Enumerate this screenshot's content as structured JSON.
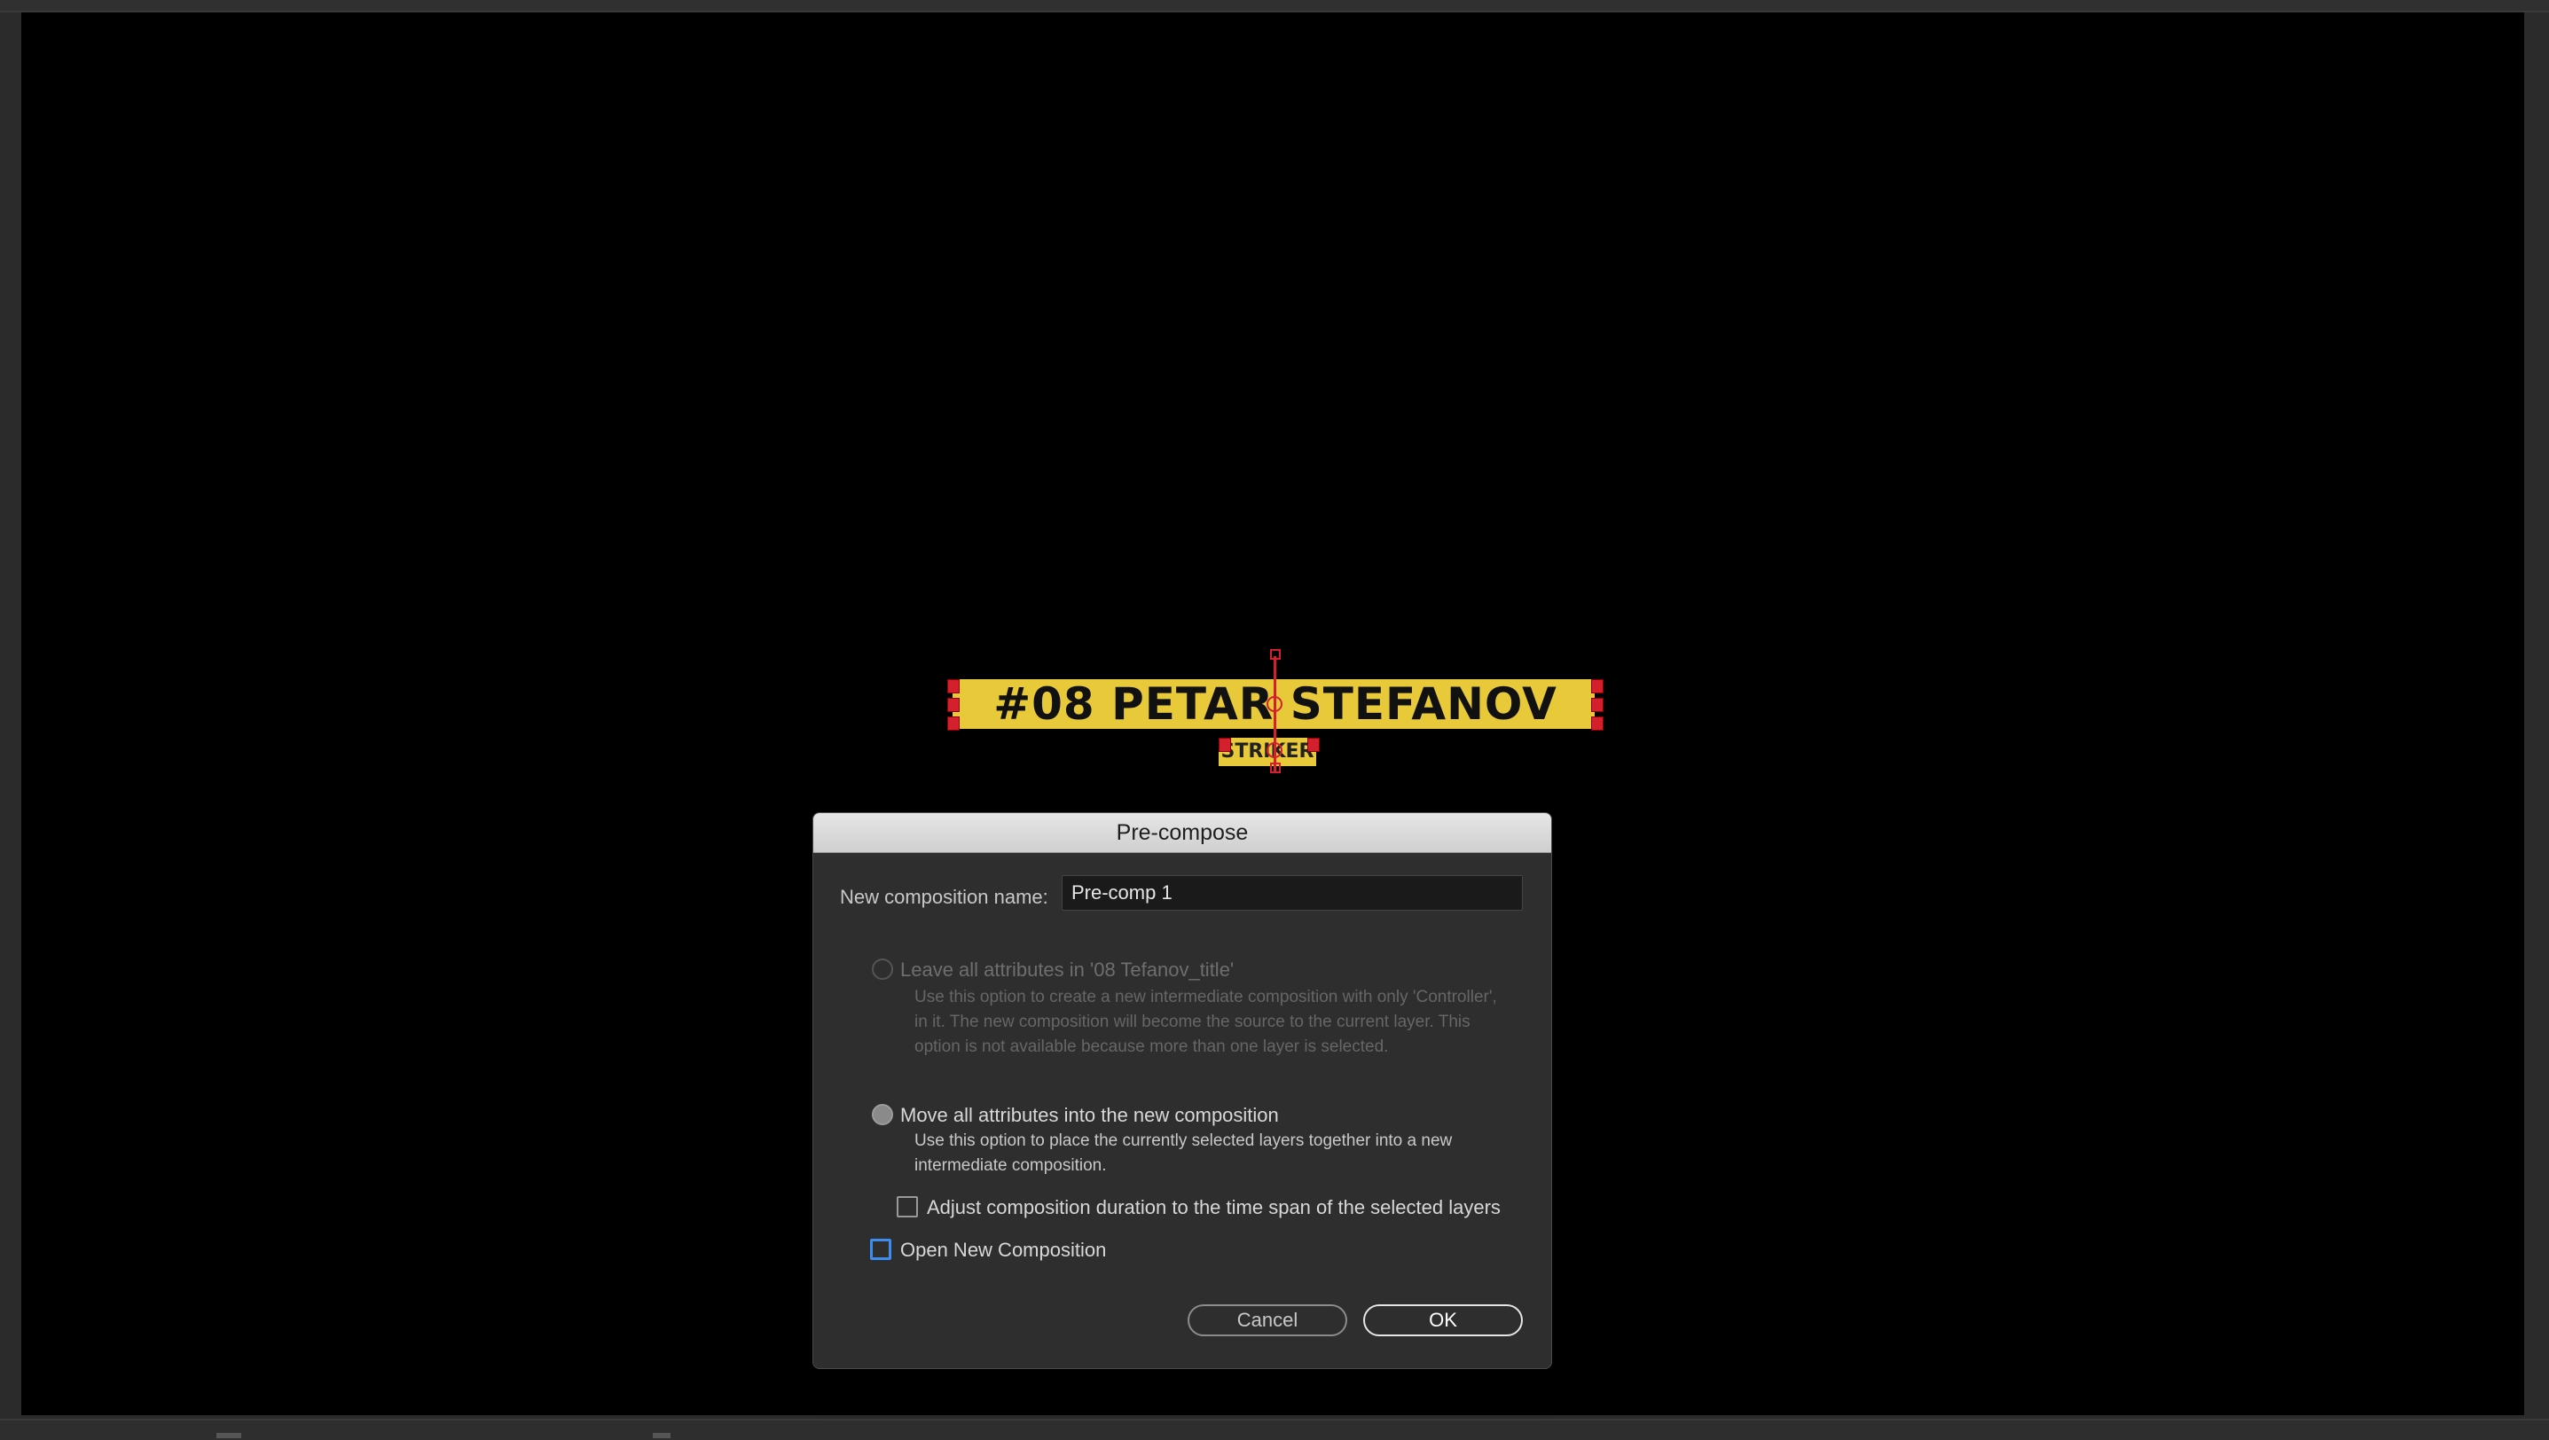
{
  "viewer": {
    "lower_third": {
      "title": "#08 PETAR STEFANOV",
      "subtitle": "STRIKER",
      "bar_color": "#e8c93a",
      "handle_color": "#d4202c"
    }
  },
  "dialog": {
    "title": "Pre-compose",
    "name_label": "New composition name:",
    "name_value": "Pre-comp 1",
    "option_leave": {
      "label": "Leave all attributes in '08 Tefanov_title'",
      "description": "Use this option to create a new intermediate composition with only 'Controller', in it. The new composition will become the source to the current layer. This option is not available because more than one layer is selected.",
      "enabled": false,
      "selected": false
    },
    "option_move": {
      "label": "Move all attributes into the new composition",
      "description": "Use this option to place the currently selected layers together into a new intermediate composition.",
      "enabled": true,
      "selected": true
    },
    "adjust_duration": {
      "label": "Adjust composition duration to the time span of the selected layers",
      "checked": false
    },
    "open_new": {
      "label": "Open New Composition",
      "checked": false,
      "focused": true
    },
    "buttons": {
      "cancel": "Cancel",
      "ok": "OK"
    }
  }
}
